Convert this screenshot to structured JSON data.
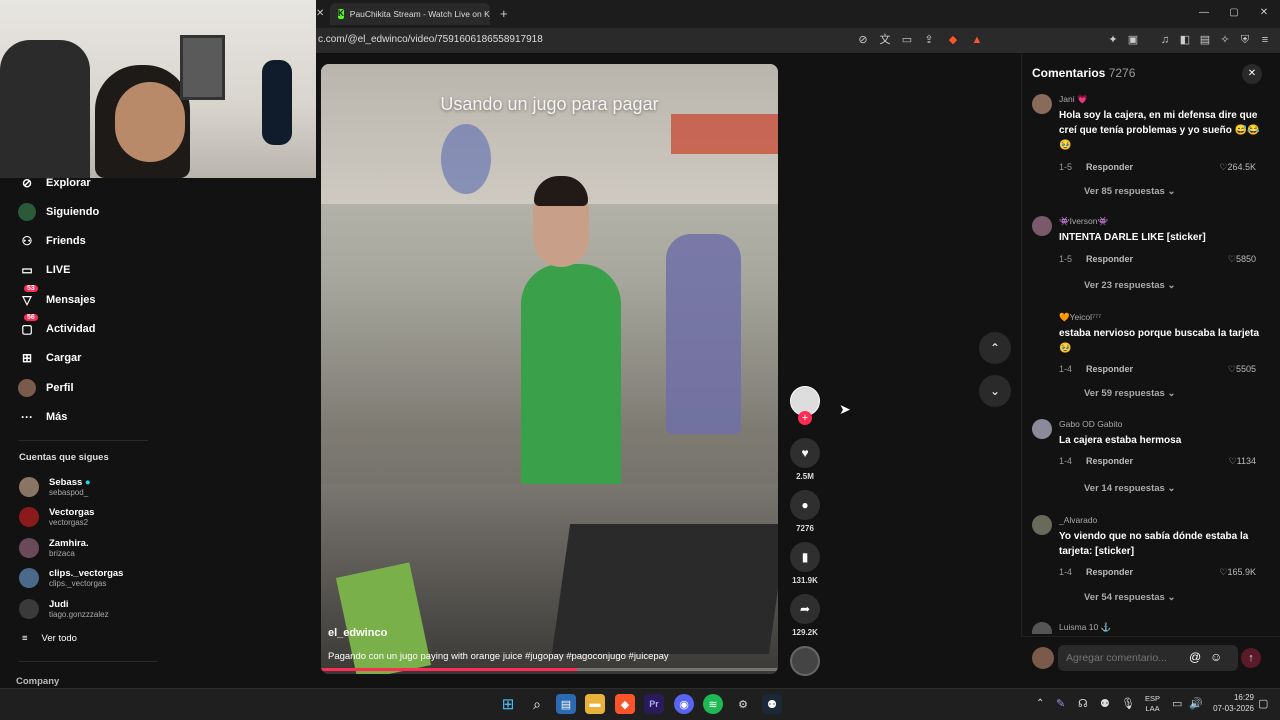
{
  "browser": {
    "tab_title": "PauChikita Stream - Watch Live on Ki",
    "new_tab": "+",
    "url": "c.com/@el_edwinco/video/7591606186558917918",
    "window_controls": [
      "—",
      "▢",
      "✕"
    ]
  },
  "sidebar": {
    "items": [
      {
        "label": "Explorar",
        "icon": "compass-icon"
      },
      {
        "label": "Siguiendo",
        "icon": "following-avatar"
      },
      {
        "label": "Friends",
        "icon": "friends-icon"
      },
      {
        "label": "LIVE",
        "icon": "live-icon"
      },
      {
        "label": "Mensajes",
        "icon": "messages-icon",
        "badge": "53"
      },
      {
        "label": "Actividad",
        "icon": "activity-icon",
        "badge": "56"
      },
      {
        "label": "Cargar",
        "icon": "upload-icon"
      },
      {
        "label": "Perfil",
        "icon": "profile-avatar"
      },
      {
        "label": "Más",
        "icon": "more-icon"
      }
    ],
    "following_header": "Cuentas que sigues",
    "following": [
      {
        "name": "Sebass",
        "handle": "sebaspod_",
        "verified": true
      },
      {
        "name": "Vectorgas",
        "handle": "vectorgas2"
      },
      {
        "name": "Zamhira.",
        "handle": "brizaca"
      },
      {
        "name": "clips._vectorgas",
        "handle": "clips._vectorgas"
      },
      {
        "name": "Judi",
        "handle": "tiago.gonzzzalez"
      }
    ],
    "see_all": "Ver todo",
    "company": "Company"
  },
  "video": {
    "overlay_text": "Usando un jugo para pagar",
    "author": "el_edwinco",
    "caption": "Pagando con un jugo paying with orange juice #jugopay #pagoconjugo #juicepay",
    "progress": 0.56
  },
  "actions": {
    "likes": "2.5M",
    "comments": "7276",
    "saves": "131.9K",
    "shares": "129.2K"
  },
  "comments_panel": {
    "title": "Comentarios",
    "count": "7276",
    "input_placeholder": "Agregar comentario...",
    "items": [
      {
        "user": "Jani 💗",
        "text": "Hola soy la cajera, en mi defensa dire que creí que tenía problemas y yo sueño 😅😂🥹",
        "age": "1-5",
        "reply": "Responder",
        "likes": "264.5K",
        "more": "Ver 85 respuestas"
      },
      {
        "user": "👾Iverson👾",
        "text": "INTENTA DARLE LIKE [sticker]",
        "age": "1-5",
        "reply": "Responder",
        "likes": "5850",
        "more": "Ver 23 respuestas"
      },
      {
        "user": "🧡Yeicol⁷⁷⁷",
        "text": "estaba nervioso porque buscaba la tarjeta 🥹",
        "age": "1-4",
        "reply": "Responder",
        "likes": "5505",
        "more": "Ver 59 respuestas"
      },
      {
        "user": "Gabo OD Gabito",
        "text": "La cajera estaba hermosa",
        "age": "1-4",
        "reply": "Responder",
        "likes": "1134",
        "more": "Ver 14 respuestas"
      },
      {
        "user": "_Alvarado",
        "text": "Yo viendo que no sabía dónde estaba la tarjeta: [sticker]",
        "age": "1-4",
        "reply": "Responder",
        "likes": "165.9K",
        "more": "Ver 54 respuestas"
      },
      {
        "user": "Luisma 10 ⚓"
      }
    ]
  },
  "taskbar": {
    "lang_top": "ESP",
    "lang_bottom": "LAA",
    "time": "16:29",
    "date": "07-03-2026"
  }
}
